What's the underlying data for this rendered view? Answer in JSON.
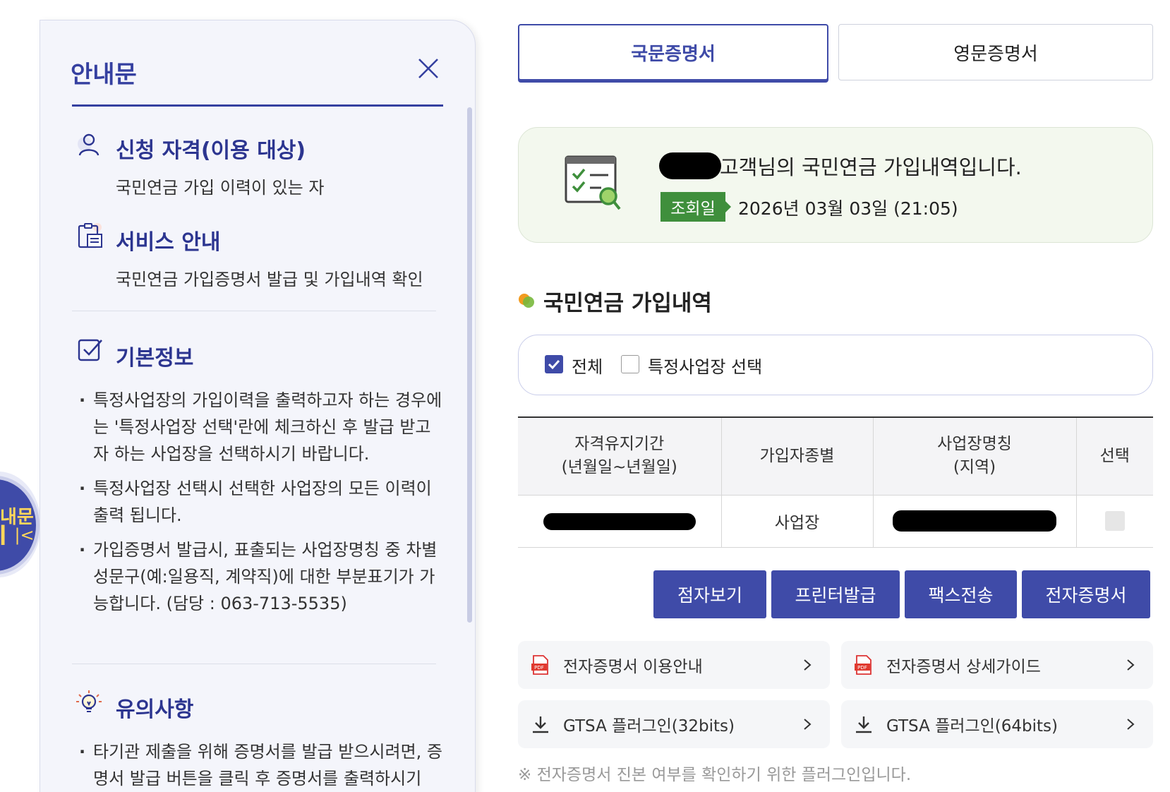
{
  "float_tab": {
    "label": "내문",
    "collapse": "▎|<"
  },
  "panel": {
    "title": "안내문",
    "sections": [
      {
        "icon": "user-icon",
        "title": "신청 자격(이용 대상)",
        "body": "국민연금 가입 이력이 있는 자"
      },
      {
        "icon": "clipboard-icon",
        "title": "서비스 안내",
        "body": "국민연금 가입증명서 발급 및 가입내역 확인"
      },
      {
        "icon": "checkbox-icon",
        "title": "기본정보",
        "bullets": [
          "특정사업장의 가입이력을 출력하고자 하는 경우에는 '특정사업장 선택'란에 체크하신 후 발급 받고자 하는 사업장을 선택하시기 바랍니다.",
          "특정사업장 선택시 선택한 사업장의 모든 이력이 출력 됩니다.",
          "가입증명서 발급시, 표출되는 사업장명칭 중 차별성문구(예:일용직, 계약직)에 대한 부분표기가 가능합니다. (담당 : 063-713-5535)"
        ]
      },
      {
        "icon": "lightbulb-icon",
        "title": "유의사항",
        "bullets": [
          "타기관 제출을 위해 증명서를 발급 받으시려면, 증명서 발급 버튼을 클릭 후 증명서를 출력하시기"
        ]
      }
    ]
  },
  "tabs": [
    {
      "label": "국문증명서",
      "active": true
    },
    {
      "label": "영문증명서",
      "active": false
    }
  ],
  "info": {
    "greeting": "고객님의 국민연금 가입내역입니다.",
    "date_label": "조회일",
    "date_value": "2026년 03월 03일 (21:05)"
  },
  "section_title": "국민연금 가입내역",
  "filter": {
    "all_label": "전체",
    "all_checked": true,
    "specific_label": "특정사업장 선택",
    "specific_checked": false
  },
  "table": {
    "headers": [
      "자격유지기간\n(년월일~년월일)",
      "가입자종별",
      "사업장명칭\n(지역)",
      "선택"
    ],
    "rows": [
      {
        "type": "사업장"
      }
    ]
  },
  "actions": [
    "점자보기",
    "프린터발급",
    "팩스전송",
    "전자증명서"
  ],
  "links": [
    {
      "icon": "pdf-icon",
      "label": "전자증명서 이용안내"
    },
    {
      "icon": "pdf-icon",
      "label": "전자증명서 상세가이드"
    },
    {
      "icon": "download-icon",
      "label": "GTSA 플러그인(32bits)"
    },
    {
      "icon": "download-icon",
      "label": "GTSA 플러그인(64bits)"
    }
  ],
  "notice": "※ 전자증명서 진본 여부를 확인하기 위한 플러그인입니다.",
  "colors": {
    "primary": "#3f4ba8",
    "green": "#3f8f3c",
    "title_blue": "#3540a0"
  }
}
